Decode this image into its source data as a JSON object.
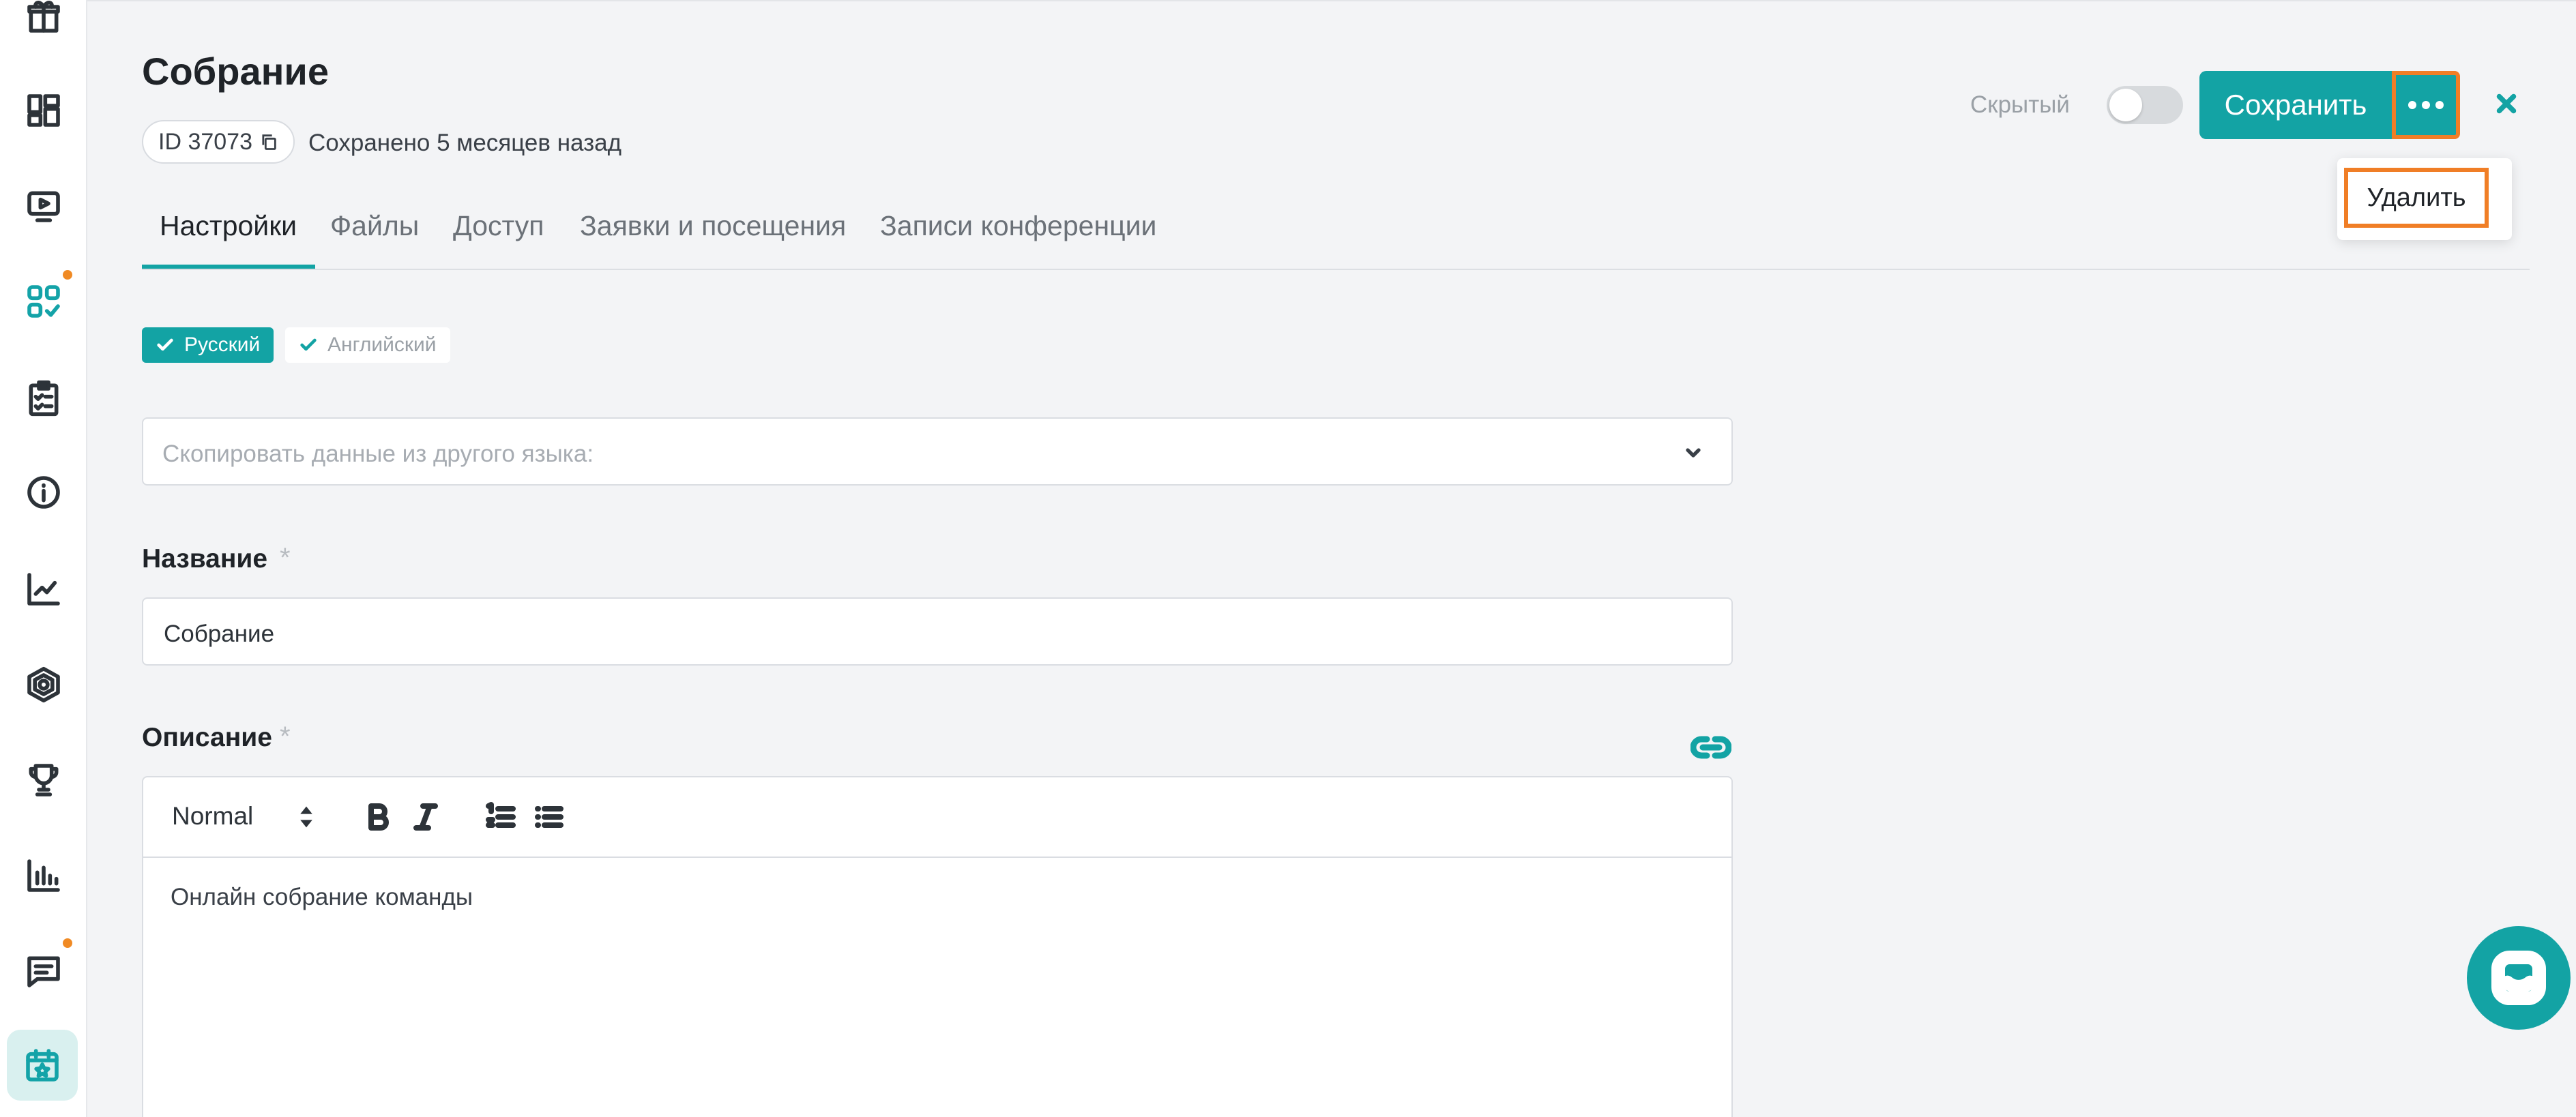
{
  "sidebar": {
    "items": [
      {
        "name": "gift-icon"
      },
      {
        "name": "dashboard-icon"
      },
      {
        "name": "video-icon"
      },
      {
        "name": "apps-check-icon",
        "badge": true
      },
      {
        "name": "clipboard-checklist-icon"
      },
      {
        "name": "info-icon"
      },
      {
        "name": "analytics-trend-icon"
      },
      {
        "name": "hexagon-icon"
      },
      {
        "name": "trophy-icon"
      },
      {
        "name": "bar-chart-icon"
      },
      {
        "name": "chat-icon",
        "badge": true
      },
      {
        "name": "calendar-star-icon",
        "active": true
      }
    ],
    "accent_color": "#14a3a8",
    "badge_color": "#f08a24"
  },
  "header": {
    "title": "Собрание",
    "id_label": "ID 37073",
    "saved_text": "Сохранено 5 месяцев назад",
    "hidden_label": "Скрытый",
    "hidden_toggle_on": false,
    "save_label": "Сохранить",
    "more_menu": {
      "delete_label": "Удалить"
    }
  },
  "tabs": [
    {
      "label": "Настройки",
      "active": true
    },
    {
      "label": "Файлы",
      "active": false
    },
    {
      "label": "Доступ",
      "active": false
    },
    {
      "label": "Заявки и посещения",
      "active": false
    },
    {
      "label": "Записи конференции",
      "active": false
    }
  ],
  "languages": [
    {
      "label": "Русский",
      "selected": true
    },
    {
      "label": "Английский",
      "selected": false
    }
  ],
  "copy_select": {
    "placeholder": "Скопировать данные из другого языка:"
  },
  "fields": {
    "name_label": "Название",
    "name_value": "Собрание",
    "description_label": "Описание",
    "required_mark": "*"
  },
  "editor": {
    "format": "Normal",
    "content": "Онлайн собрание команды"
  },
  "colors": {
    "primary": "#13a3a4",
    "highlight": "#f07e26"
  }
}
